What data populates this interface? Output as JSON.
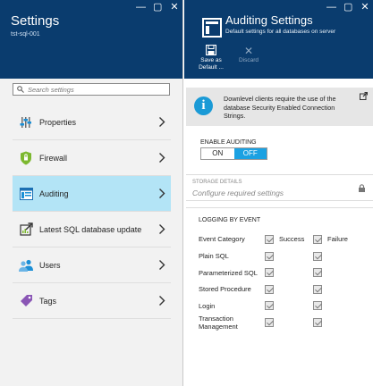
{
  "window_controls": [
    "—",
    "▢",
    "✕"
  ],
  "left_blade": {
    "title": "Settings",
    "subtitle": "tst-sql-001",
    "search_placeholder": "Search settings",
    "items": [
      {
        "label": "Properties",
        "icon": "properties-icon"
      },
      {
        "label": "Firewall",
        "icon": "firewall-icon"
      },
      {
        "label": "Auditing",
        "icon": "auditing-icon",
        "selected": true
      },
      {
        "label": "Latest SQL database update",
        "icon": "update-icon"
      },
      {
        "label": "Users",
        "icon": "users-icon"
      },
      {
        "label": "Tags",
        "icon": "tag-icon"
      }
    ]
  },
  "right_blade": {
    "title": "Auditing Settings",
    "subtitle": "Default settings for all databases on server",
    "toolbar": {
      "save_label": "Save as Default ...",
      "discard_label": "Discard"
    },
    "banner": "Downlevel clients require the use of the database Security Enabled Connection Strings.",
    "enable_auditing": {
      "label": "ENABLE AUDITING",
      "on": "ON",
      "off": "OFF",
      "value": "OFF"
    },
    "storage": {
      "label": "STORAGE DETAILS",
      "value": "Configure required settings"
    },
    "logging": {
      "title": "LOGGING BY EVENT",
      "col_category": "Event Category",
      "col_success": "Success",
      "col_failure": "Failure",
      "rows": [
        {
          "label": "Plain SQL",
          "success": true,
          "failure": true
        },
        {
          "label": "Parameterized SQL",
          "success": true,
          "failure": true
        },
        {
          "label": "Stored Procedure",
          "success": true,
          "failure": true
        },
        {
          "label": "Login",
          "success": true,
          "failure": true
        },
        {
          "label": "Transaction Management",
          "success": true,
          "failure": true
        }
      ]
    }
  },
  "colors": {
    "header_bg": "#0a3c6e",
    "selected_bg": "#b3e4f6",
    "accent": "#1ba1e2"
  }
}
